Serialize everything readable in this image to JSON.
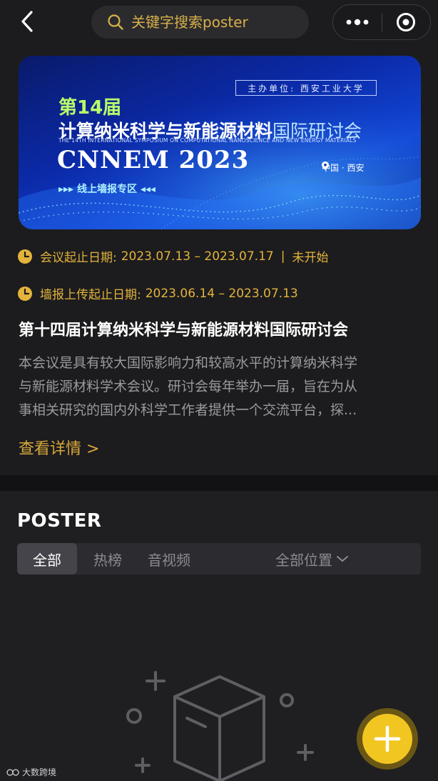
{
  "search": {
    "placeholder": "关键字搜索poster"
  },
  "banner": {
    "host": "主办单位: 西安工业大学",
    "edition": "第14届",
    "title_main": "计算纳米科学与新能源材料",
    "title_suffix": "国际研讨会",
    "title_en": "THE 14TH INTERNATIONAL SYMPOSIUM ON COMPUTATIONAL NANOSCIENCE AND NEW ENERGY MATERIALS",
    "brand": "CNNEM 2023",
    "location": "中国 · 西安",
    "online_label": "▸▸▸ 线上墙报专区 ◂◂◂"
  },
  "meeting": {
    "dates_label": "会议起止日期:",
    "dates_value": "2023.07.13 – 2023.07.17",
    "status_sep": "|",
    "status": "未开始",
    "upload_label": "墙报上传起止日期:",
    "upload_value": "2023.06.14 – 2023.07.13",
    "title": "第十四届计算纳米科学与新能源材料国际研讨会",
    "desc_lines": [
      "本会议是具有较大国际影响力和较高水平的计算纳米科学",
      "与新能源材料学术会议。研讨会每年举办一届，旨在为从",
      "事相关研究的国内外科学工作者提供一个交流平台，探..."
    ],
    "detail_link": "查看详情 >"
  },
  "poster": {
    "heading": "POSTER",
    "tabs": [
      "全部",
      "热榜",
      "音视频"
    ],
    "location_filter": "全部位置"
  },
  "watermark": "大数跨境",
  "colors": {
    "accent": "#e3b33c",
    "fab": "#f2c621",
    "background": "#1c1c1e"
  },
  "icons": [
    "back-arrow-icon",
    "search-icon",
    "more-dots-icon",
    "close-target-icon",
    "clock-icon",
    "chevron-down-icon",
    "empty-box-icon",
    "plus-icon"
  ]
}
